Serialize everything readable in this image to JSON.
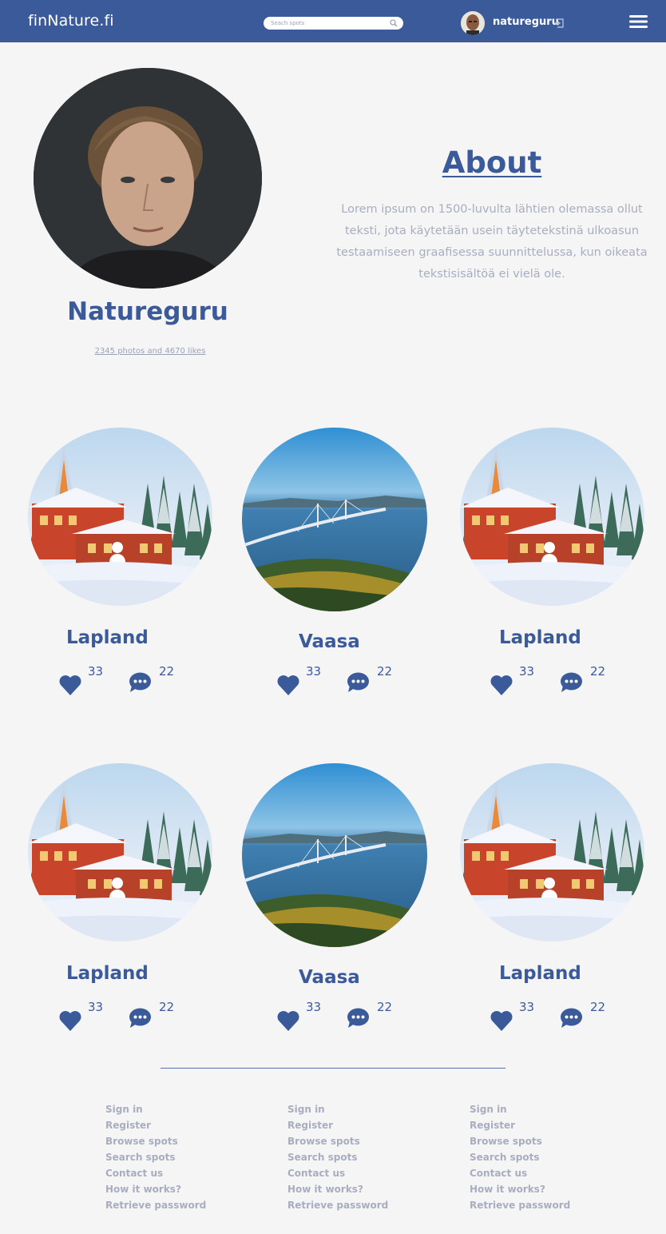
{
  "header": {
    "logo": "finNature.fi",
    "search_placeholder": "Seach spots",
    "username": "natureguru"
  },
  "profile": {
    "name": "Natureguru",
    "stats": "2345 photos and 4670 likes"
  },
  "about": {
    "title": "About",
    "text": "Lorem ipsum on 1500-luvulta lähtien olemassa ollut teksti, jota käytetään usein täytetekstinä ulkoasun testaamiseen graafisessa suunnittelussa, kun oikeata tekstisisältöä ei vielä ole."
  },
  "spots": [
    {
      "title": "Lapland",
      "likes": "33",
      "comments": "22",
      "image": "lapland-snow-house"
    },
    {
      "title": "Vaasa",
      "likes": "33",
      "comments": "22",
      "image": "vaasa-bridge-sea"
    },
    {
      "title": "Lapland",
      "likes": "33",
      "comments": "22",
      "image": "lapland-snow-house"
    },
    {
      "title": "Lapland",
      "likes": "33",
      "comments": "22",
      "image": "lapland-snow-house"
    },
    {
      "title": "Vaasa",
      "likes": "33",
      "comments": "22",
      "image": "vaasa-bridge-sea"
    },
    {
      "title": "Lapland",
      "likes": "33",
      "comments": "22",
      "image": "lapland-snow-house"
    }
  ],
  "footer": {
    "columns": [
      {
        "links": [
          "Sign in",
          "Register",
          "Browse spots",
          "Search spots",
          "Contact us",
          "How it works?",
          "Retrieve password"
        ]
      },
      {
        "links": [
          "Sign in",
          "Register",
          "Browse spots",
          "Search spots",
          "Contact us",
          "How it works?",
          "Retrieve password"
        ]
      },
      {
        "links": [
          "Sign in",
          "Register",
          "Browse spots",
          "Search spots",
          "Contact us",
          "How it works?",
          "Retrieve password"
        ]
      }
    ]
  },
  "colors": {
    "brand": "#3b5a9a",
    "muted_text": "#a8aec0",
    "background": "#f5f5f5"
  }
}
